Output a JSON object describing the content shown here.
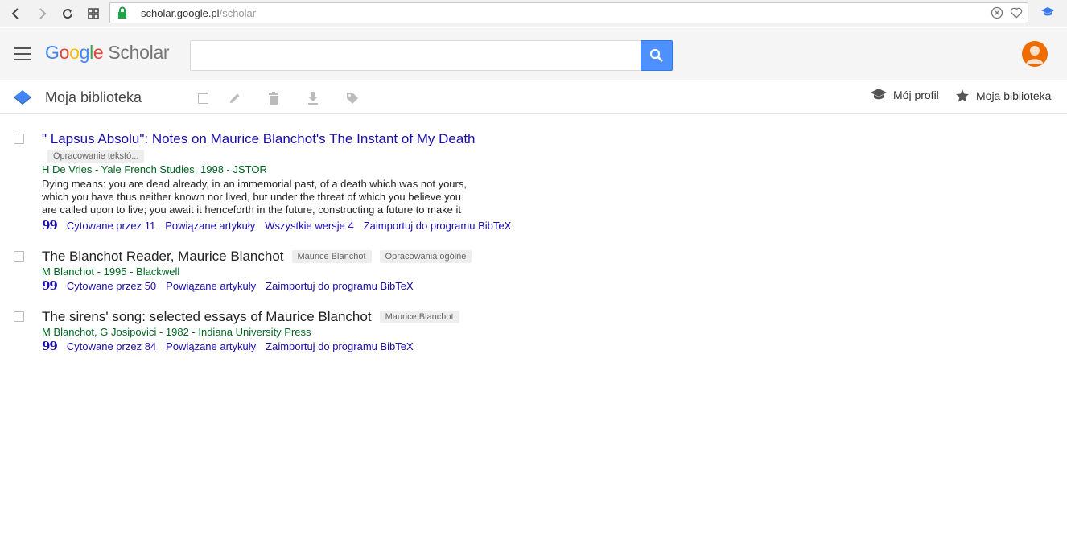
{
  "browser": {
    "url_host": "scholar.google.pl",
    "url_path": "/scholar"
  },
  "header": {
    "logo_letters": [
      "G",
      "o",
      "o",
      "g",
      "l",
      "e"
    ],
    "logo_product": "Scholar",
    "search": {
      "value": "",
      "placeholder": ""
    }
  },
  "toolbar": {
    "title": "Moja biblioteka",
    "profile_label": "Mój profil",
    "library_label": "Moja biblioteka"
  },
  "results": [
    {
      "title": "\" Lapsus Absolu\": Notes on Maurice Blanchot's The Instant of My Death",
      "labels": [
        "Opracowanie tekstó..."
      ],
      "meta": "H De Vries - Yale French Studies, 1998 - JSTOR",
      "snippet": [
        "Dying means: you are dead already, in an immemorial past, of a death which was not yours,",
        "which you have thus neither known nor lived, but under the threat of which you believe you",
        "are called upon to live; you await it henceforth in the future, constructing a future to make it"
      ],
      "links": [
        "Cytowane przez 11",
        "Powiązane artykuły",
        "Wszystkie wersje 4",
        "Zaimportuj do programu BibTeX"
      ]
    },
    {
      "title": "The Blanchot Reader, Maurice Blanchot",
      "labels": [
        "Maurice Blanchot",
        "Opracowania ogólne"
      ],
      "meta": "M Blanchot - 1995 - Blackwell",
      "links": [
        "Cytowane przez 50",
        "Powiązane artykuły",
        "Zaimportuj do programu BibTeX"
      ]
    },
    {
      "title": "The sirens' song: selected essays of Maurice Blanchot",
      "labels": [
        "Maurice Blanchot"
      ],
      "meta": "M Blanchot, G Josipovici - 1982 - Indiana University Press",
      "links": [
        "Cytowane przez 84",
        "Powiązane artykuły",
        "Zaimportuj do programu BibTeX"
      ]
    }
  ],
  "colors": {
    "link": "#1a0dab",
    "meta_green": "#006621",
    "search_blue": "#4d90fe",
    "avatar_orange": "#ef6c00"
  },
  "icons": [
    "back-icon",
    "forward-icon",
    "reload-icon",
    "tabs-grid-icon",
    "lock-icon",
    "shield-x-icon",
    "heart-icon",
    "scholar-extension-icon",
    "menu-icon",
    "search-icon",
    "avatar-icon",
    "library-logo-icon",
    "select-all-checkbox",
    "edit-icon",
    "trash-icon",
    "download-icon",
    "label-icon",
    "graduation-cap-icon",
    "star-icon",
    "quote-icon"
  ]
}
